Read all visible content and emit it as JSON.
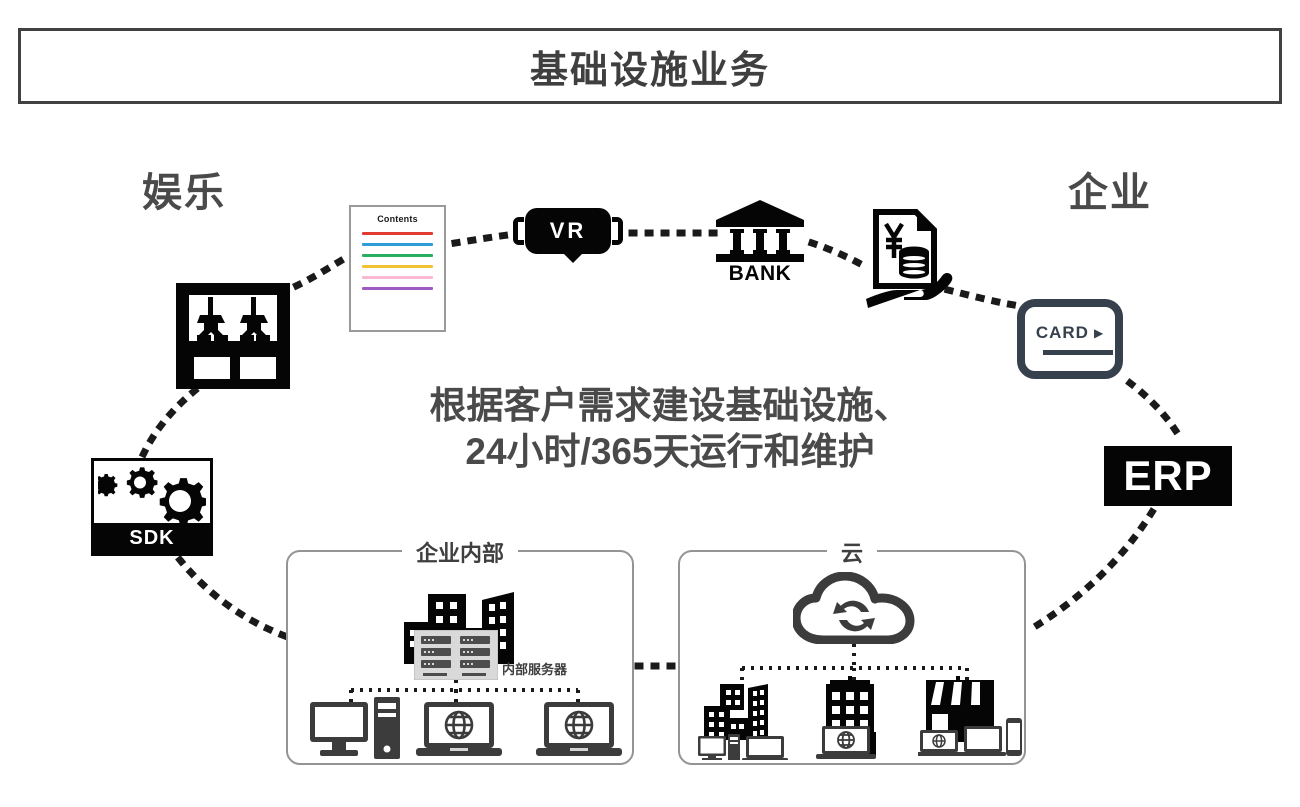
{
  "header": {
    "title": "基础设施业务"
  },
  "regions": [
    {
      "id": "entertainment",
      "label": "娱乐"
    },
    {
      "id": "corporate",
      "label": "企业"
    }
  ],
  "center_message": {
    "line1": "根据客户需求建设基础设施、",
    "line2": "24小时/365天运行和维护"
  },
  "nodes": {
    "claw_machine": {
      "icon": "claw-machine-icon",
      "label": ""
    },
    "sdk": {
      "icon": "gears-icon",
      "label": "SDK"
    },
    "contents_doc": {
      "icon": "document-icon",
      "title": "Contents",
      "line_colors": [
        "#e03c31",
        "#2d9cdb",
        "#27ae60",
        "#f2c233",
        "#f9b9d2",
        "#a05bc0"
      ]
    },
    "vr": {
      "icon": "vr-headset-icon",
      "label": "VR"
    },
    "bank": {
      "icon": "bank-icon",
      "label": "BANK"
    },
    "payment": {
      "icon": "hand-holding-invoice-icon",
      "currency_symbol": "¥"
    },
    "card": {
      "icon": "card-reader-icon",
      "label": "CARD",
      "arrow": "▶"
    },
    "erp": {
      "icon": "erp-badge-icon",
      "label": "ERP"
    }
  },
  "panels": [
    {
      "id": "internal",
      "title": "企业内部",
      "server_caption": "内部服务器",
      "icons": [
        "office-buildings-icon",
        "server-rack-icon",
        "desktop-pc-icon",
        "pc-tower-icon",
        "laptop-globe-icon",
        "laptop-globe-icon"
      ]
    },
    {
      "id": "cloud",
      "title": "云",
      "icons": [
        "cloud-sync-icon",
        "city-buildings-icon",
        "desktop-pc-icon",
        "pc-tower-icon",
        "laptop-icon",
        "office-building-icon",
        "laptop-globe-icon",
        "storefront-icon",
        "laptop-globe-icon",
        "tablet-icon",
        "smartphone-icon"
      ]
    }
  ],
  "colors": {
    "ink": "#050505",
    "title_border": "#414141",
    "label_gray": "#4a4a4a",
    "panel_border": "#949494",
    "card_accent": "#36414d",
    "server_fill": "#d9d9d9",
    "dotted": "#1a1a1a"
  }
}
